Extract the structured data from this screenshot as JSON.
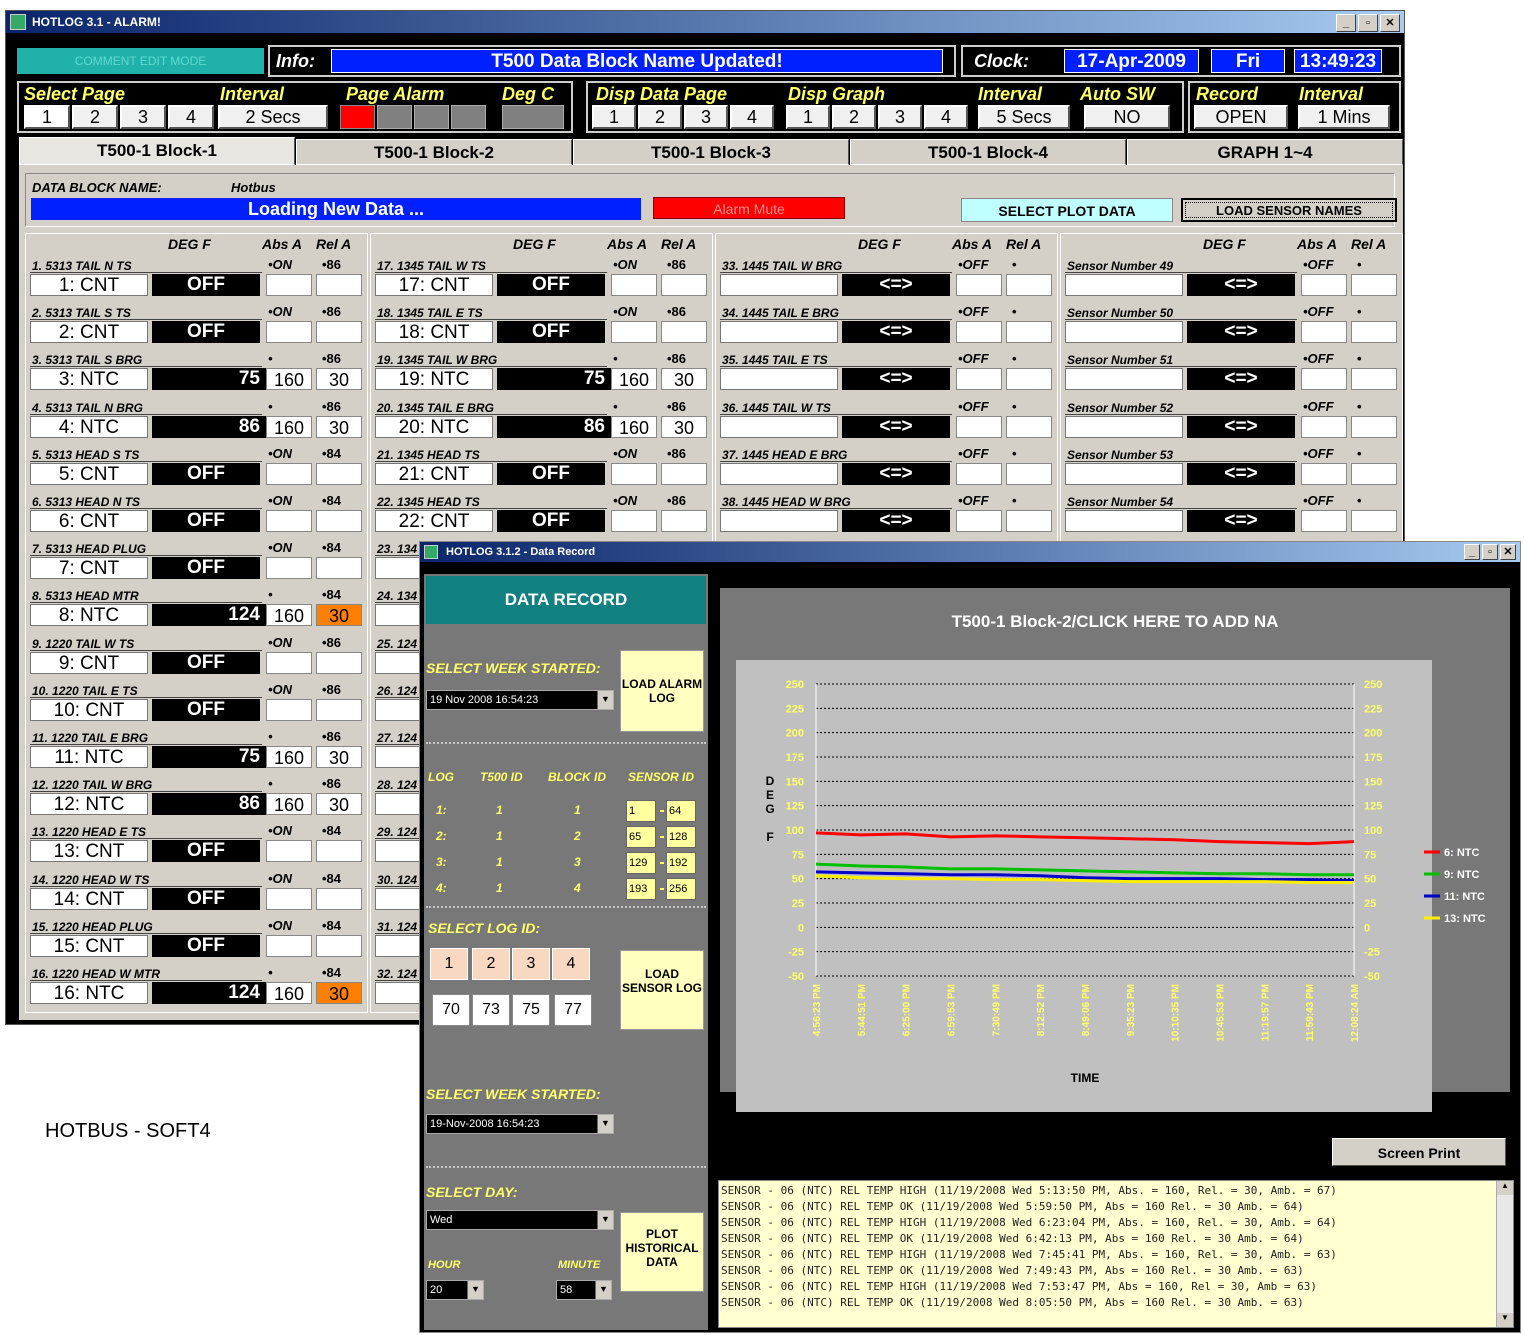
{
  "main": {
    "title": "HOTLOG 3.1 - ALARM!",
    "top_left_btn": "COMMENT EDIT MODE",
    "info_label": "Info:",
    "info_text": "T500 Data Block Name Updated!",
    "clock_label": "Clock:",
    "date": "17-Apr-2009",
    "day": "Fri",
    "time": "13:49:23",
    "select_page_label": "Select Page",
    "pages": [
      "1",
      "2",
      "3",
      "4"
    ],
    "interval_label": "Interval",
    "interval_value": "2 Secs",
    "page_alarm_label": "Page Alarm",
    "deg_c_label": "Deg C",
    "disp_data_page_label": "Disp Data Page",
    "disp_graph_label": "Disp Graph",
    "interval2_label": "Interval",
    "interval2_value": "5 Secs",
    "auto_sw_label": "Auto SW",
    "auto_sw_value": "NO",
    "record_label": "Record",
    "record_value": "OPEN",
    "interval3_label": "Interval",
    "interval3_value": "1 Mins",
    "tabs": [
      "T500-1 Block-1",
      "T500-1 Block-2",
      "T500-1 Block-3",
      "T500-1 Block-4",
      "GRAPH 1~4"
    ],
    "block_name_label": "DATA BLOCK NAME:",
    "block_name_value": "Hotbus",
    "loading_text": "Loading New Data ...",
    "alarm_mute": "Alarm Mute",
    "select_plot": "SELECT PLOT DATA",
    "load_sensor": "LOAD SENSOR NAMES",
    "hdr_deg": "DEG F",
    "hdr_abs": "Abs A",
    "hdr_rel": "Rel A",
    "col1": [
      {
        "name": "1. 5313 TAIL N TS",
        "id": "1: CNT",
        "val": "OFF",
        "a": "•ON",
        "r": "•86",
        "av": "",
        "rv": ""
      },
      {
        "name": "2. 5313 TAIL S TS",
        "id": "2: CNT",
        "val": "OFF",
        "a": "•ON",
        "r": "•86",
        "av": "",
        "rv": ""
      },
      {
        "name": "3. 5313 TAIL S BRG",
        "id": "3: NTC",
        "val": "75",
        "a": "•",
        "r": "•86",
        "av": "160",
        "rv": "30"
      },
      {
        "name": "4. 5313 TAIL N BRG",
        "id": "4: NTC",
        "val": "86",
        "a": "•",
        "r": "•86",
        "av": "160",
        "rv": "30"
      },
      {
        "name": "5. 5313 HEAD S TS",
        "id": "5: CNT",
        "val": "OFF",
        "a": "•ON",
        "r": "•84",
        "av": "",
        "rv": ""
      },
      {
        "name": "6. 5313 HEAD N TS",
        "id": "6: CNT",
        "val": "OFF",
        "a": "•ON",
        "r": "•84",
        "av": "",
        "rv": ""
      },
      {
        "name": "7. 5313 HEAD PLUG",
        "id": "7: CNT",
        "val": "OFF",
        "a": "•ON",
        "r": "•84",
        "av": "",
        "rv": ""
      },
      {
        "name": "8. 5313 HEAD MTR",
        "id": "8: NTC",
        "val": "124",
        "a": "•",
        "r": "•84",
        "av": "160",
        "rv": "30"
      },
      {
        "name": "9. 1220 TAIL W TS",
        "id": "9: CNT",
        "val": "OFF",
        "a": "•ON",
        "r": "•86",
        "av": "",
        "rv": ""
      },
      {
        "name": "10. 1220 TAIL E TS",
        "id": "10: CNT",
        "val": "OFF",
        "a": "•ON",
        "r": "•86",
        "av": "",
        "rv": ""
      },
      {
        "name": "11. 1220 TAIL E BRG",
        "id": "11: NTC",
        "val": "75",
        "a": "•",
        "r": "•86",
        "av": "160",
        "rv": "30"
      },
      {
        "name": "12. 1220 TAIL W BRG",
        "id": "12: NTC",
        "val": "86",
        "a": "•",
        "r": "•86",
        "av": "160",
        "rv": "30"
      },
      {
        "name": "13. 1220 HEAD E TS",
        "id": "13: CNT",
        "val": "OFF",
        "a": "•ON",
        "r": "•84",
        "av": "",
        "rv": ""
      },
      {
        "name": "14. 1220 HEAD W TS",
        "id": "14: CNT",
        "val": "OFF",
        "a": "•ON",
        "r": "•84",
        "av": "",
        "rv": ""
      },
      {
        "name": "15. 1220 HEAD PLUG",
        "id": "15: CNT",
        "val": "OFF",
        "a": "•ON",
        "r": "•84",
        "av": "",
        "rv": ""
      },
      {
        "name": "16. 1220 HEAD W MTR",
        "id": "16: NTC",
        "val": "124",
        "a": "•",
        "r": "•84",
        "av": "160",
        "rv": "30"
      }
    ],
    "col2": [
      {
        "name": "17. 1345 TAIL W TS",
        "id": "17: CNT",
        "val": "OFF",
        "a": "•ON",
        "r": "•86",
        "av": "",
        "rv": ""
      },
      {
        "name": "18. 1345 TAIL E TS",
        "id": "18: CNT",
        "val": "OFF",
        "a": "•ON",
        "r": "•86",
        "av": "",
        "rv": ""
      },
      {
        "name": "19. 1345 TAIL W BRG",
        "id": "19: NTC",
        "val": "75",
        "a": "•",
        "r": "•86",
        "av": "160",
        "rv": "30"
      },
      {
        "name": "20. 1345 TAIL E BRG",
        "id": "20: NTC",
        "val": "86",
        "a": "•",
        "r": "•86",
        "av": "160",
        "rv": "30"
      },
      {
        "name": "21. 1345 HEAD TS",
        "id": "21: CNT",
        "val": "OFF",
        "a": "•ON",
        "r": "•86",
        "av": "",
        "rv": ""
      },
      {
        "name": "22. 1345 HEAD TS",
        "id": "22: CNT",
        "val": "OFF",
        "a": "•ON",
        "r": "•86",
        "av": "",
        "rv": ""
      },
      {
        "name": "23. 134",
        "id": "23:",
        "val": "",
        "a": "",
        "r": "",
        "av": "",
        "rv": ""
      },
      {
        "name": "24. 134",
        "id": "24:",
        "val": "",
        "a": "",
        "r": "",
        "av": "",
        "rv": ""
      },
      {
        "name": "25. 124",
        "id": "25:",
        "val": "",
        "a": "",
        "r": "",
        "av": "",
        "rv": ""
      },
      {
        "name": "26. 124",
        "id": "26:",
        "val": "",
        "a": "",
        "r": "",
        "av": "",
        "rv": ""
      },
      {
        "name": "27. 124",
        "id": "27:",
        "val": "",
        "a": "",
        "r": "",
        "av": "",
        "rv": ""
      },
      {
        "name": "28. 124",
        "id": "28:",
        "val": "",
        "a": "",
        "r": "",
        "av": "",
        "rv": ""
      },
      {
        "name": "29. 124",
        "id": "29:",
        "val": "",
        "a": "",
        "r": "",
        "av": "",
        "rv": ""
      },
      {
        "name": "30. 124",
        "id": "30:",
        "val": "",
        "a": "",
        "r": "",
        "av": "",
        "rv": ""
      },
      {
        "name": "31. 124",
        "id": "31:",
        "val": "",
        "a": "",
        "r": "",
        "av": "",
        "rv": ""
      },
      {
        "name": "32. 124",
        "id": "32:",
        "val": "",
        "a": "",
        "r": "",
        "av": "",
        "rv": ""
      }
    ],
    "col3": [
      {
        "name": "33. 1445 TAIL W BRG",
        "id": "",
        "val": "<=>",
        "a": "•OFF",
        "r": "•",
        "av": "",
        "rv": ""
      },
      {
        "name": "34. 1445 TAIL E BRG",
        "id": "",
        "val": "<=>",
        "a": "•OFF",
        "r": "•",
        "av": "",
        "rv": ""
      },
      {
        "name": "35. 1445 TAIL E TS",
        "id": "",
        "val": "<=>",
        "a": "•OFF",
        "r": "•",
        "av": "",
        "rv": ""
      },
      {
        "name": "36. 1445 TAIL W TS",
        "id": "",
        "val": "<=>",
        "a": "•OFF",
        "r": "•",
        "av": "",
        "rv": ""
      },
      {
        "name": "37. 1445 HEAD E BRG",
        "id": "",
        "val": "<=>",
        "a": "•OFF",
        "r": "•",
        "av": "",
        "rv": ""
      },
      {
        "name": "38. 1445 HEAD W BRG",
        "id": "",
        "val": "<=>",
        "a": "•OFF",
        "r": "•",
        "av": "",
        "rv": ""
      }
    ],
    "col4": [
      {
        "name": "Sensor Number 49",
        "id": "",
        "val": "<=>",
        "a": "•OFF",
        "r": "•",
        "av": "",
        "rv": ""
      },
      {
        "name": "Sensor Number 50",
        "id": "",
        "val": "<=>",
        "a": "•OFF",
        "r": "•",
        "av": "",
        "rv": ""
      },
      {
        "name": "Sensor Number 51",
        "id": "",
        "val": "<=>",
        "a": "•OFF",
        "r": "•",
        "av": "",
        "rv": ""
      },
      {
        "name": "Sensor Number 52",
        "id": "",
        "val": "<=>",
        "a": "•OFF",
        "r": "•",
        "av": "",
        "rv": ""
      },
      {
        "name": "Sensor Number 53",
        "id": "",
        "val": "<=>",
        "a": "•OFF",
        "r": "•",
        "av": "",
        "rv": ""
      },
      {
        "name": "Sensor Number 54",
        "id": "",
        "val": "<=>",
        "a": "•OFF",
        "r": "•",
        "av": "",
        "rv": ""
      }
    ]
  },
  "caption": "HOTBUS - SOFT4",
  "record": {
    "title": "HOTLOG 3.1.2 - Data Record",
    "header": "DATA RECORD",
    "select_week_label": "SELECT WEEK STARTED:",
    "week_value": "19 Nov 2008 16:54:23",
    "load_alarm": "LOAD ALARM LOG",
    "log_hdr": [
      "LOG",
      "T500 ID",
      "BLOCK ID",
      "SENSOR ID"
    ],
    "logs": [
      {
        "log": "1:",
        "t500": "1",
        "block": "1",
        "s1": "1",
        "s2": "64"
      },
      {
        "log": "2:",
        "t500": "1",
        "block": "2",
        "s1": "65",
        "s2": "128"
      },
      {
        "log": "3:",
        "t500": "1",
        "block": "3",
        "s1": "129",
        "s2": "192"
      },
      {
        "log": "4:",
        "t500": "1",
        "block": "4",
        "s1": "193",
        "s2": "256"
      }
    ],
    "select_log_label": "SELECT LOG ID:",
    "log_ids": [
      "1",
      "2",
      "3",
      "4"
    ],
    "log_vals": [
      "70",
      "73",
      "75",
      "77"
    ],
    "load_sensor_log": "LOAD SENSOR LOG",
    "select_week2_label": "SELECT WEEK STARTED:",
    "week2_value": "19-Nov-2008 16:54:23",
    "select_day_label": "SELECT DAY:",
    "day_value": "Wed",
    "hour_label": "HOUR",
    "minute_label": "MINUTE",
    "hour_value": "20",
    "minute_value": "58",
    "plot_hist": "PLOT HISTORICAL DATA",
    "screen_print": "Screen Print",
    "log_lines": [
      "SENSOR - 06 (NTC)    REL TEMP HIGH (11/19/2008 Wed 5:13:50 PM, Abs. = 160, Rel. = 30, Amb. = 67)",
      "SENSOR - 06 (NTC)    REL TEMP OK (11/19/2008 Wed 5:59:50 PM, Abs = 160 Rel. = 30 Amb. = 64)",
      "SENSOR - 06 (NTC)    REL TEMP HIGH (11/19/2008 Wed 6:23:04 PM, Abs. = 160, Rel. = 30, Amb. = 64)",
      "SENSOR - 06 (NTC)    REL TEMP OK (11/19/2008 Wed 6:42:13 PM, Abs = 160 Rel. = 30 Amb. = 64)",
      "SENSOR - 06 (NTC)    REL TEMP HIGH (11/19/2008 Wed 7:45:41 PM, Abs. = 160, Rel. = 30, Amb. = 63)",
      "SENSOR - 06 (NTC)    REL TEMP OK (11/19/2008 Wed 7:49:43 PM, Abs = 160 Rel. = 30 Amb. = 63)",
      "SENSOR - 06 (NTC)    REL TEMP HIGH (11/19/2008 Wed 7:53:47 PM, Abs = 160, Rel = 30, Amb = 63)",
      "SENSOR - 06 (NTC)    REL TEMP OK (11/19/2008 Wed 8:05:50 PM, Abs = 160 Rel. = 30 Amb. = 63)"
    ]
  },
  "chart_data": {
    "type": "line",
    "title": "T500-1 Block-2/CLICK HERE TO ADD NA",
    "ylabel": "DEG F",
    "xlabel": "TIME",
    "ylim": [
      -50,
      250
    ],
    "yticks": [
      250,
      225,
      200,
      175,
      150,
      125,
      100,
      75,
      50,
      25,
      0,
      -25,
      -50
    ],
    "x": [
      "4:56:23 PM",
      "5:44:51 PM",
      "6:25:00 PM",
      "6:59:53 PM",
      "7:30:49 PM",
      "8:12:52 PM",
      "8:49:06 PM",
      "9:35:23 PM",
      "10:10:35 PM",
      "10:45:53 PM",
      "11:19:57 PM",
      "11:59:43 PM",
      "12:08:24 AM"
    ],
    "grid": true,
    "legend": "right",
    "series": [
      {
        "name": "6: NTC",
        "color": "#ff0000",
        "values": [
          97,
          95,
          96,
          93,
          94,
          93,
          92,
          91,
          90,
          88,
          87,
          86,
          88
        ]
      },
      {
        "name": "9: NTC",
        "color": "#00c000",
        "values": [
          65,
          63,
          62,
          60,
          60,
          59,
          58,
          57,
          56,
          55,
          55,
          54,
          54
        ]
      },
      {
        "name": "11: NTC",
        "color": "#0000cc",
        "values": [
          57,
          56,
          55,
          54,
          54,
          53,
          51,
          50,
          50,
          50,
          49,
          49,
          48
        ]
      },
      {
        "name": "13: NTC",
        "color": "#ffee00",
        "values": [
          53,
          51,
          50,
          50,
          49,
          49,
          48,
          47,
          47,
          47,
          47,
          46,
          46
        ]
      }
    ]
  }
}
